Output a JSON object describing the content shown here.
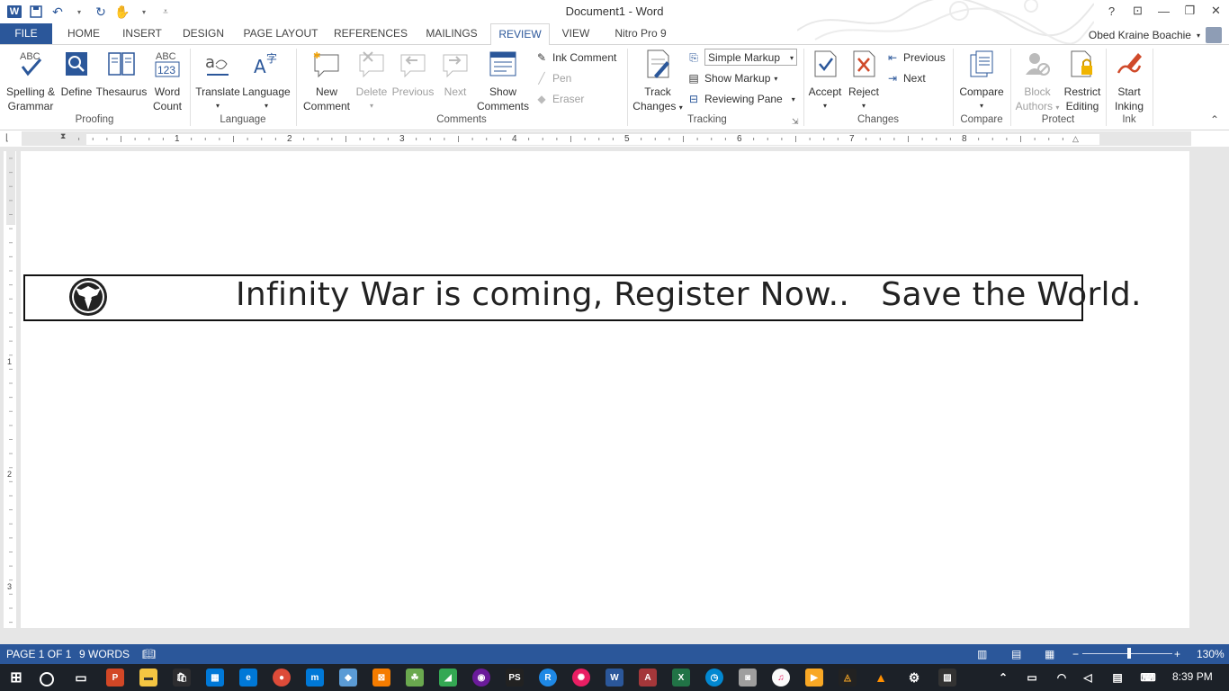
{
  "window": {
    "title": "Document1 - Word"
  },
  "account": {
    "name": "Obed Kraine Boachie"
  },
  "tabs": [
    "FILE",
    "HOME",
    "INSERT",
    "DESIGN",
    "PAGE LAYOUT",
    "REFERENCES",
    "MAILINGS",
    "REVIEW",
    "VIEW",
    "Nitro Pro 9"
  ],
  "active_tab": "REVIEW",
  "ribbon": {
    "proofing": {
      "label": "Proofing",
      "spelling": "Spelling &",
      "spelling2": "Grammar",
      "define": "Define",
      "thesaurus": "Thesaurus",
      "word_count": "Word",
      "word_count2": "Count",
      "abc": "ABC",
      "abc123": "123"
    },
    "language": {
      "label": "Language",
      "translate": "Translate",
      "language": "Language"
    },
    "comments": {
      "label": "Comments",
      "new": "New",
      "new2": "Comment",
      "delete": "Delete",
      "previous": "Previous",
      "next": "Next",
      "show": "Show",
      "show2": "Comments",
      "ink_comment": "Ink Comment",
      "pen": "Pen",
      "eraser": "Eraser"
    },
    "tracking": {
      "label": "Tracking",
      "track": "Track",
      "track2": "Changes",
      "markup_value": "Simple Markup",
      "show_markup": "Show Markup",
      "reviewing_pane": "Reviewing Pane"
    },
    "changes": {
      "label": "Changes",
      "accept": "Accept",
      "reject": "Reject",
      "previous": "Previous",
      "next": "Next"
    },
    "compare": {
      "label": "Compare",
      "compare": "Compare"
    },
    "protect": {
      "label": "Protect",
      "block": "Block",
      "block2": "Authors",
      "restrict": "Restrict",
      "restrict2": "Editing"
    },
    "ink": {
      "label": "Ink",
      "start": "Start",
      "start2": "Inking"
    }
  },
  "ruler": {
    "h_ticks": [
      "1",
      "2",
      "3",
      "4",
      "5",
      "6",
      "7",
      "8"
    ],
    "v_ticks": [
      "1",
      "2",
      "3"
    ]
  },
  "document": {
    "banner_text": "Infinity War is coming, Register Now..   Save the World."
  },
  "status": {
    "page": "PAGE 1 OF 1",
    "words": "9 WORDS",
    "zoom": "130%"
  },
  "taskbar": {
    "time": "8:39 PM"
  },
  "colors": {
    "accent": "#2b579a",
    "taskbar": "#1c2128"
  }
}
